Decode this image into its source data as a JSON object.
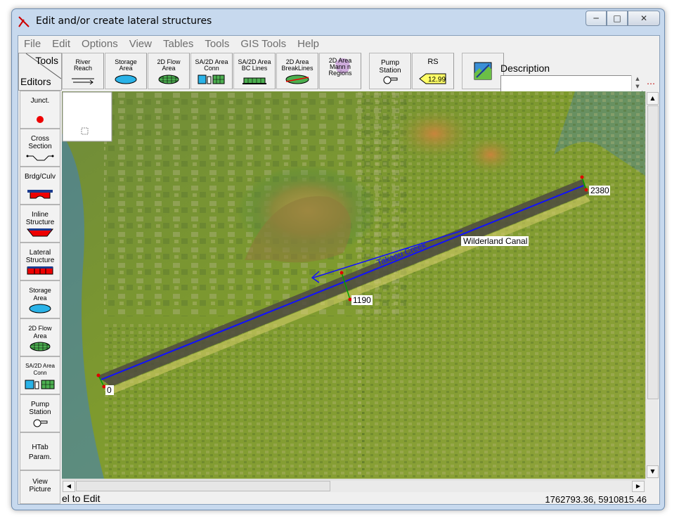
{
  "window": {
    "title": "Edit and/or create lateral structures"
  },
  "menu": [
    "File",
    "Edit",
    "Options",
    "View",
    "Tables",
    "Tools",
    "GIS Tools",
    "Help"
  ],
  "tool_header": {
    "tools": "Tools",
    "editors": "Editors"
  },
  "toolbar": [
    {
      "line1": "River",
      "line2": "Reach",
      "line3": ""
    },
    {
      "line1": "Storage",
      "line2": "Area",
      "line3": ""
    },
    {
      "line1": "2D Flow",
      "line2": "Area",
      "line3": ""
    },
    {
      "line1": "SA/2D Area",
      "line2": "Conn",
      "line3": ""
    },
    {
      "line1": "SA/2D Area",
      "line2": "BC Lines",
      "line3": ""
    },
    {
      "line1": "2D Area",
      "line2": "BreakLines",
      "line3": ""
    },
    {
      "line1": "2D Area",
      "line2": "Mann n",
      "line3": "Regions"
    },
    {
      "line1": "Pump",
      "line2": "Station",
      "line3": ""
    },
    {
      "line1": "RS",
      "line2": "12.99",
      "line3": ""
    }
  ],
  "description": {
    "label": "Description",
    "value": ""
  },
  "sidebar": [
    {
      "line1": "Junct.",
      "line2": ""
    },
    {
      "line1": "Cross",
      "line2": "Section"
    },
    {
      "line1": "Brdg/Culv",
      "line2": ""
    },
    {
      "line1": "Inline",
      "line2": "Structure"
    },
    {
      "line1": "Lateral",
      "line2": "Structure"
    },
    {
      "line1": "Storage",
      "line2": "Area"
    },
    {
      "line1": "2D Flow",
      "line2": "Area"
    },
    {
      "line1": "SA/2D Area",
      "line2": "Conn"
    },
    {
      "line1": "Pump",
      "line2": "Station"
    },
    {
      "line1": "HTab",
      "line2": "Param."
    },
    {
      "line1": "View",
      "line2": "Picture"
    }
  ],
  "map": {
    "reach_name": "Wilderland Canal",
    "river_name": "Takapu Creek",
    "stations": [
      "2380",
      "1190",
      "0"
    ],
    "colors": {
      "reach": "#1010ff",
      "xs_marker": "#e00000"
    }
  },
  "status": {
    "left": "el to Edit",
    "coords": "1762793.36, 5910815.46"
  }
}
